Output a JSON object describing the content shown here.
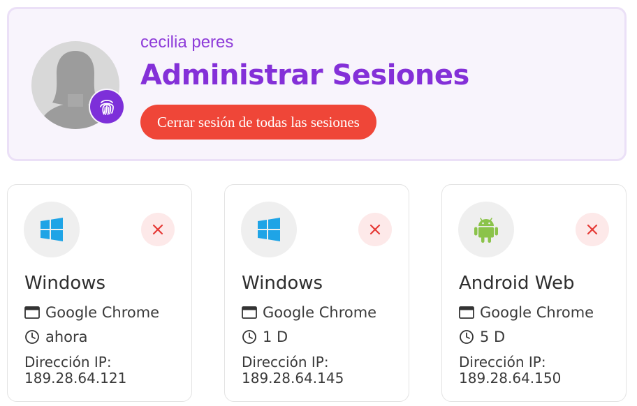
{
  "profile": {
    "username": "cecilia peres",
    "page_title": "Administrar Sesiones",
    "logout_all_label": "Cerrar sesión de todas las sesiones"
  },
  "colors": {
    "accent_purple": "#8430d8",
    "danger_red": "#ef4638",
    "windows_blue": "#1fa4e6",
    "android_green": "#8bc34a"
  },
  "sessions": [
    {
      "os": "Windows",
      "os_icon": "windows-logo-icon",
      "browser": "Google Chrome",
      "time": "ahora",
      "ip_label": "Dirección IP:",
      "ip": "189.28.64.121"
    },
    {
      "os": "Windows",
      "os_icon": "windows-logo-icon",
      "browser": "Google Chrome",
      "time": "1 D",
      "ip_label": "Dirección IP:",
      "ip": "189.28.64.145"
    },
    {
      "os": "Android Web",
      "os_icon": "android-logo-icon",
      "browser": "Google Chrome",
      "time": "5 D",
      "ip_label": "Dirección IP:",
      "ip": "189.28.64.150"
    }
  ]
}
